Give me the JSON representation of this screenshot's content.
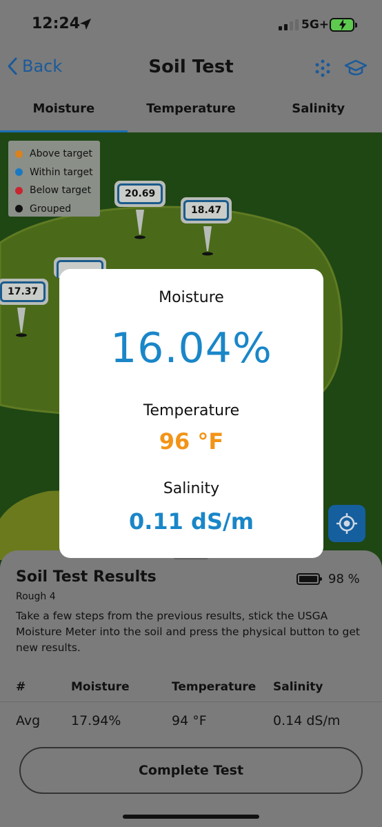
{
  "status_bar": {
    "time": "12:24",
    "network": "5G+"
  },
  "nav": {
    "back_label": "Back",
    "title": "Soil Test"
  },
  "tabs": [
    {
      "label": "Moisture",
      "active": true
    },
    {
      "label": "Temperature",
      "active": false
    },
    {
      "label": "Salinity",
      "active": false
    }
  ],
  "legend": [
    {
      "label": "Above target",
      "color": "#d9821f"
    },
    {
      "label": "Within target",
      "color": "#1b79c2"
    },
    {
      "label": "Below target",
      "color": "#c8252f"
    },
    {
      "label": "Grouped",
      "color": "#111111"
    }
  ],
  "pins": [
    {
      "value": "20.69"
    },
    {
      "value": "18.47"
    },
    {
      "value": "17.37"
    }
  ],
  "modal": {
    "moisture_label": "Moisture",
    "moisture_value": "16.04%",
    "temperature_label": "Temperature",
    "temperature_value": "96 °F",
    "salinity_label": "Salinity",
    "salinity_value": "0.11 dS/m"
  },
  "sheet": {
    "title": "Soil Test Results",
    "subtitle": "Rough 4",
    "battery_pct": "98 %",
    "description": "Take a few steps from the previous results, stick the USGA Moisture Meter into the soil and press the physical button to get new results.",
    "table": {
      "headers": [
        "#",
        "Moisture",
        "Temperature",
        "Salinity"
      ],
      "rows": [
        [
          "Avg",
          "17.94%",
          "94 °F",
          "0.14 dS/m"
        ]
      ]
    },
    "complete_label": "Complete Test"
  },
  "colors": {
    "accent": "#1b6fb3",
    "temperature": "#f29418",
    "moisture": "#1a86c8"
  },
  "icons": [
    "location-arrow-icon",
    "signal-icon",
    "battery-charging-icon",
    "back-chevron-icon",
    "dots-grid-icon",
    "graduation-cap-icon",
    "crosshair-icon",
    "battery-icon"
  ]
}
